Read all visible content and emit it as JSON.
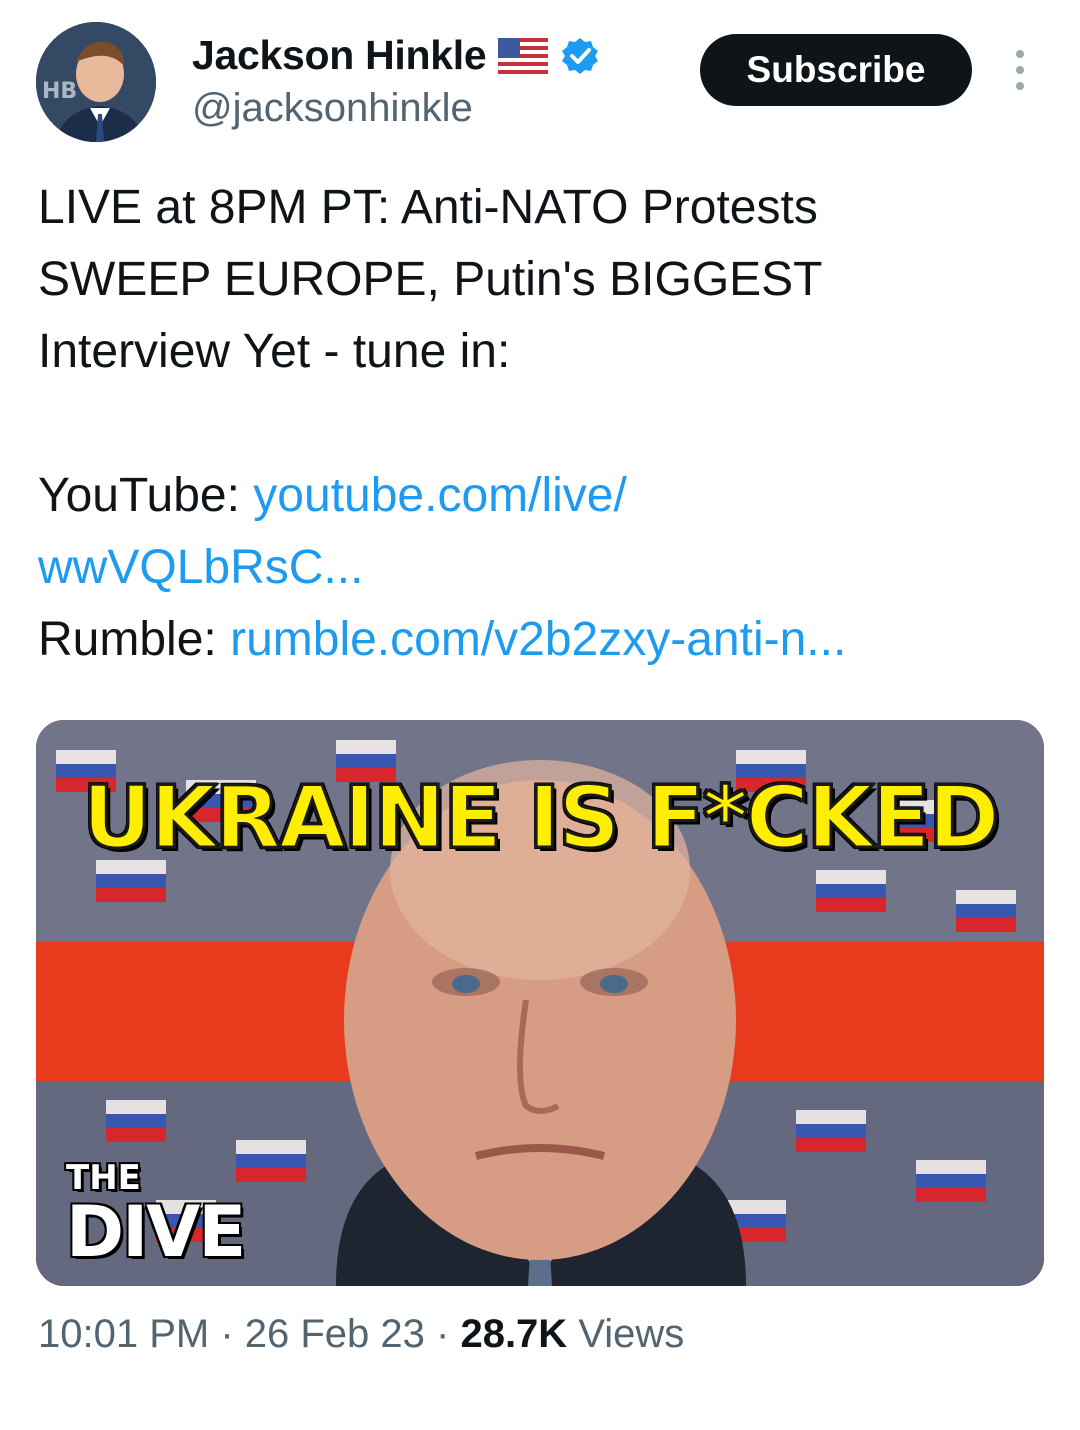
{
  "author": {
    "name": "Jackson Hinkle",
    "handle": "@jacksonhinkle",
    "avatar_text": "HB",
    "verified_icon": "verified-badge-icon",
    "flag_icon": "us-flag-icon"
  },
  "actions": {
    "subscribe_label": "Subscribe",
    "more_icon": "more-vertical-icon"
  },
  "tweet": {
    "line1": "LIVE at 8PM PT: Anti-NATO Protests",
    "line2": "SWEEP EUROPE, Putin's BIGGEST",
    "line3": "Interview Yet - tune in:",
    "youtube_label": "YouTube: ",
    "youtube_link_1": "youtube.com/live/",
    "youtube_link_2": "wwVQLbRsC...",
    "rumble_label": "Rumble: ",
    "rumble_link": "rumble.com/v2b2zxy-anti-n..."
  },
  "media": {
    "headline": "UKRAINE IS F*CKED",
    "logo_top": "THE",
    "logo_bottom": "DIVE"
  },
  "meta": {
    "time": "10:01 PM",
    "sep1": " · ",
    "date": "26 Feb 23",
    "sep2": " · ",
    "views_count": "28.7K",
    "views_label": " Views"
  },
  "colors": {
    "link": "#1d9bf0",
    "secondary_text": "#536471",
    "primary_text": "#0f1419",
    "thumbnail_red": "#e83a1d",
    "headline_yellow": "#ffee00"
  }
}
